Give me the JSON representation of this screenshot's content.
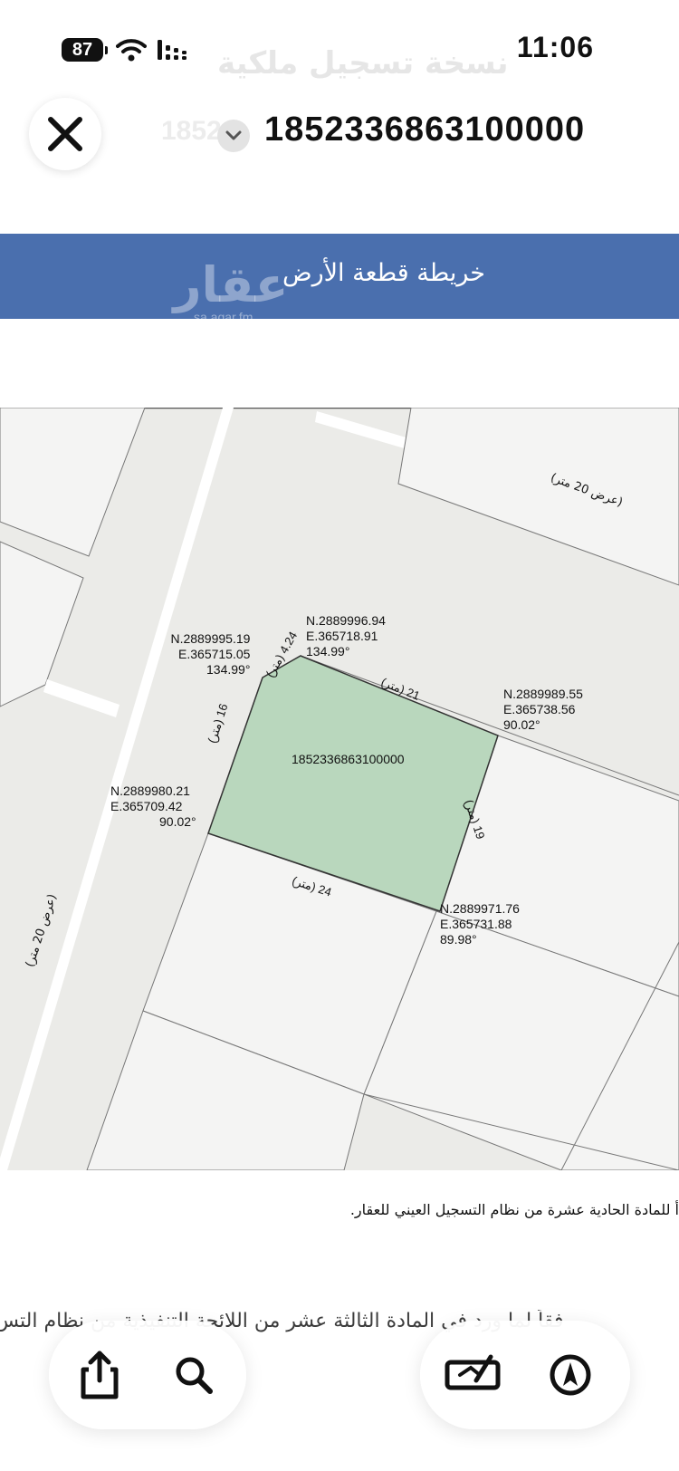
{
  "status_bar": {
    "battery": "87",
    "time": "11:06",
    "icons": [
      "battery-icon",
      "wifi-icon",
      "signal-icon"
    ]
  },
  "header": {
    "ghost_title": "نسخة تسجيل ملكية",
    "ghost_number": "1852",
    "document_number": "1852336863100000",
    "close_icon": "close-icon",
    "chevron_icon": "chevron-down-icon"
  },
  "banner": {
    "title": "خريطة قطعة الأرض",
    "watermark": "عقار",
    "watermark_sub": "sa.aqar.fm",
    "color": "#4a6fae"
  },
  "map": {
    "parcel_id": "1852336863100000",
    "parcel_color": "#b9d7bd",
    "road_labels": [
      "(عرض 20 متر)",
      "(عرض 20 متر)"
    ],
    "dimensions": [
      "(متر) 4.24",
      "21 (متر)",
      "16 (متر)",
      "19 (متر)",
      "24 (متر)"
    ],
    "corners": [
      {
        "n": "N.2889995.19",
        "e": "E.365715.05",
        "angle": "134.99°"
      },
      {
        "n": "N.2889996.94",
        "e": "E.365718.91",
        "angle": "134.99°"
      },
      {
        "n": "N.2889989.55",
        "e": "E.365738.56",
        "angle": "90.02°"
      },
      {
        "n": "N.2889980.21",
        "e": "E.365709.42",
        "angle": "90.02°"
      },
      {
        "n": "N.2889971.76",
        "e": "E.365731.88",
        "angle": "89.98°"
      }
    ]
  },
  "document_text": {
    "line1": "أ للمادة الحادية عشرة من نظام التسجيل العيني للعقار.",
    "line2": "فقاً لما ورد في المادة الثالثة عشر من اللائحة التنفيذية من نظام التس"
  },
  "toolbar": {
    "share_icon": "share-icon",
    "search_icon": "search-icon",
    "markup_icon": "markup-icon",
    "navigate_icon": "navigate-icon"
  }
}
